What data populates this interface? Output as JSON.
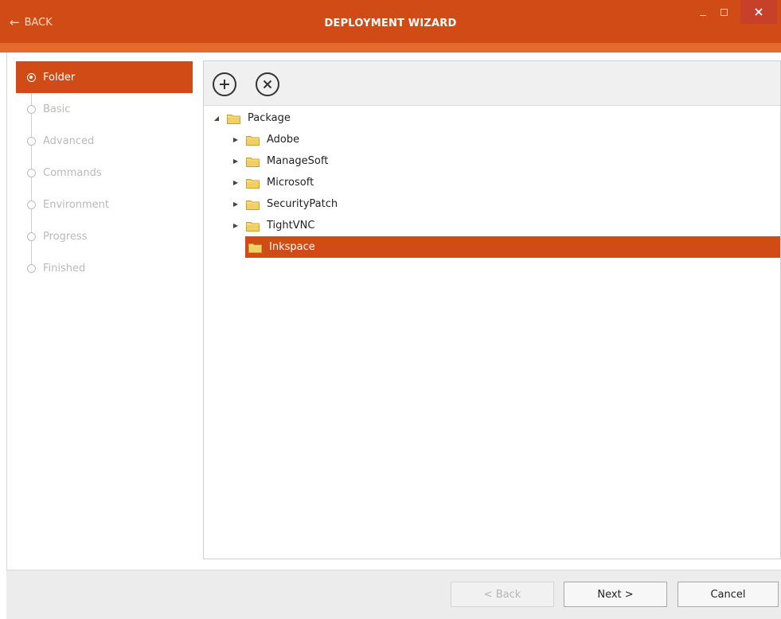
{
  "titlebar": {
    "back_label": "BACK",
    "title": "DEPLOYMENT WIZARD"
  },
  "steps": [
    {
      "label": "Folder",
      "active": true
    },
    {
      "label": "Basic",
      "active": false
    },
    {
      "label": "Advanced",
      "active": false
    },
    {
      "label": "Commands",
      "active": false
    },
    {
      "label": "Environment",
      "active": false
    },
    {
      "label": "Progress",
      "active": false
    },
    {
      "label": "Finished",
      "active": false
    }
  ],
  "toolbar": {
    "add_icon": "plus-circle-icon",
    "delete_icon": "x-circle-icon"
  },
  "tree": {
    "root": {
      "label": "Package",
      "expanded": true
    },
    "children": [
      {
        "label": "Adobe",
        "expandable": true
      },
      {
        "label": "ManageSoft",
        "expandable": true
      },
      {
        "label": "Microsoft",
        "expandable": true
      },
      {
        "label": "SecurityPatch",
        "expandable": true
      },
      {
        "label": "TightVNC",
        "expandable": true
      },
      {
        "label": "Inkspace",
        "expandable": false,
        "selected": true
      }
    ]
  },
  "footer": {
    "back_label": "< Back",
    "next_label": "Next >",
    "cancel_label": "Cancel"
  },
  "colors": {
    "accent": "#d04b16",
    "accent_light": "#e56a2e",
    "folder": "#f2cf62"
  }
}
